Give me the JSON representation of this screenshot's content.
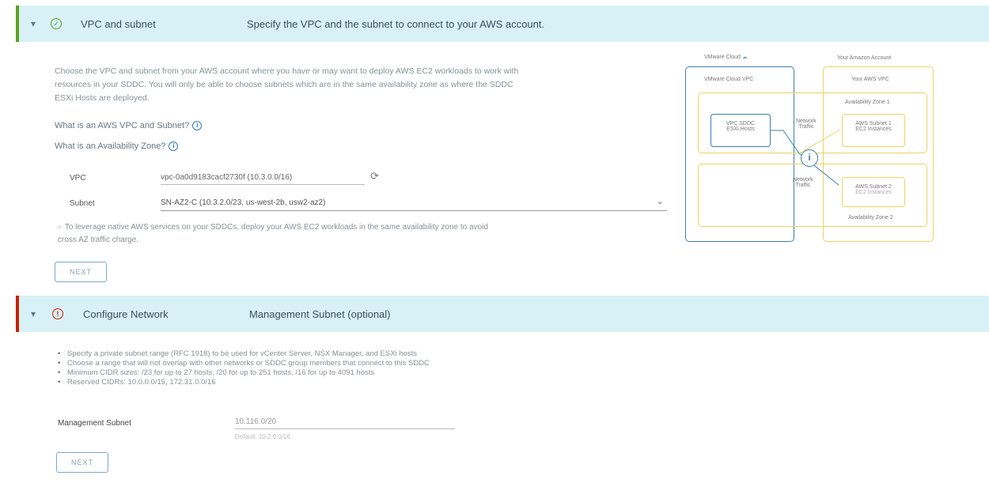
{
  "section1": {
    "title": "VPC and subnet",
    "description": "Specify the VPC and the subnet to connect to your AWS account.",
    "intro_line1": "Choose the VPC and subnet from your AWS account where you have or may want to deploy AWS EC2 workloads to work with",
    "intro_line2": "resources in your SDDC. You will only be able to choose subnets which are in the same availability zone as where the SDDC",
    "intro_line3": "ESXi Hosts are deployed.",
    "link_vpc_subnet": "What is an AWS VPC and Subnet?",
    "link_az": "What is an Availability Zone?",
    "vpc_label": "VPC",
    "vpc_value": "vpc-0a0d9183cacf2730f (10.3.0.0/16)",
    "subnet_label": "Subnet",
    "subnet_value": "SN-AZ2-C (10.3.2.0/23, us-west-2b, usw2-az2)",
    "tip_line1": "To leverage native AWS services on your SDDCs, deploy your AWS EC2 workloads in the same availability zone to avoid",
    "tip_line2": "cross AZ traffic charge.",
    "next_label": "NEXT"
  },
  "diagram": {
    "vmware_cloud": "VMware Cloud",
    "your_amazon_account": "Your Amazon Account",
    "vmware_cloud_vpc": "VMware Cloud VPC",
    "your_aws_vpc": "Your AWS VPC",
    "az1": "Availability Zone 1",
    "az2": "Availability Zone 2",
    "vpc_sddc": "VPC SDDC",
    "esxi_hosts": "ESXi Hosts",
    "network_traffic_1": "Network",
    "network_traffic_1b": "Traffic",
    "network_traffic_2": "Network",
    "network_traffic_2b": "Traffic",
    "aws_subnet1": "AWS Subnet 1",
    "ec2_instances": "EC2 Instances",
    "aws_subnet2": "AWS Subnet 2",
    "ec2_instances2": "EC2 Instances",
    "info_glyph": "i"
  },
  "section2": {
    "title": "Configure Network",
    "description": "Management Subnet (optional)",
    "bullets": [
      "Specify a private subnet range (RFC 1918) to be used for vCenter Server, NSX Manager, and ESXi hosts",
      "Choose a range that will not overlap with other networks or SDDC group members that connect to this SDDC",
      "Minimum CIDR sizes: /23 for up to 27 hosts, /20 for up to 251 hosts, /16 for up to 4091 hosts",
      "Reserved CIDRs: 10.0.0.0/15, 172.31.0.0/16"
    ],
    "mgmt_label": "Management Subnet",
    "mgmt_value": "10.116.0/20",
    "mgmt_hint": "Default: 10.2.0.0/16",
    "next_label": "NEXT"
  },
  "colors": {
    "header_bg": "#d8f1f7",
    "success": "#5aa220",
    "error": "#c92100",
    "link": "#2b7bbf",
    "diagram_blue": "#3b7fb5",
    "diagram_yellow": "#e8d560"
  },
  "icons": {
    "chevron": "▾",
    "check": "✓",
    "error": "!",
    "refresh": "⟳",
    "dropdown": "⌄",
    "tip": "○",
    "cloud": "☁",
    "info": "i"
  }
}
